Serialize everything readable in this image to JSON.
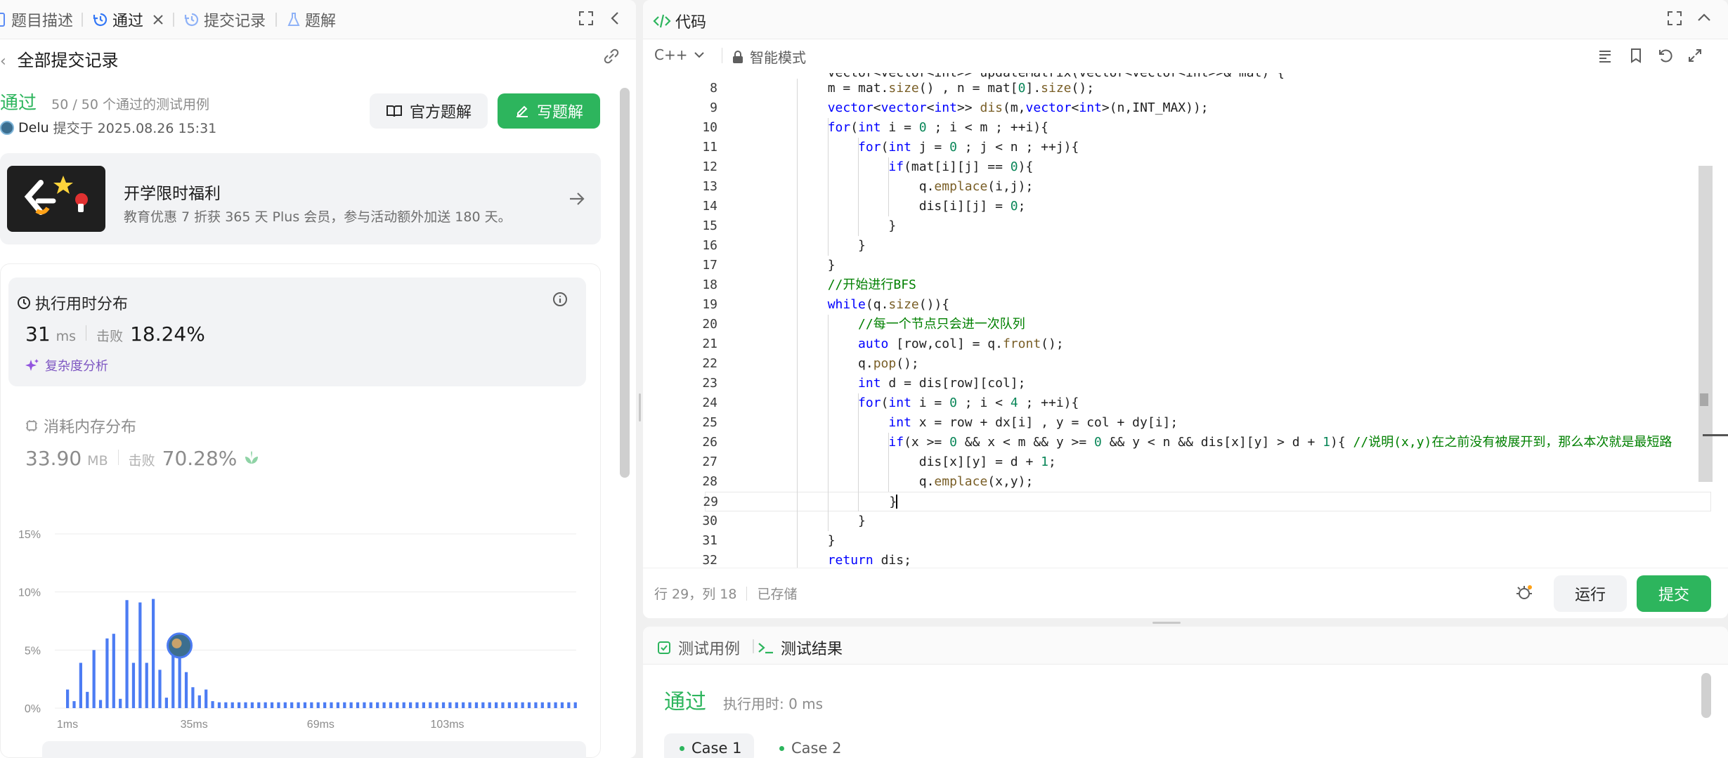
{
  "left_tabs": {
    "description": "题目描述",
    "accepted": "通过",
    "submissions": "提交记录",
    "solutions": "题解"
  },
  "submission": {
    "header": "全部提交记录",
    "status": "通过",
    "passed_cases": "50 / 50 个通过的测试用例",
    "user": "Delu",
    "submitted_at": "提交于 2025.08.26 15:31",
    "official_solution_btn": "官方题解",
    "write_solution_btn": "写题解"
  },
  "promo": {
    "title": "开学限时福利",
    "desc": "教育优惠 7 折获 365 天 Plus 会员，参与活动额外加送 180 天。"
  },
  "runtime": {
    "title": "执行用时分布",
    "value": "31",
    "unit": "ms",
    "beats_label": "击败",
    "beats": "18.24%",
    "complexity_link": "复杂度分析"
  },
  "memory": {
    "title": "消耗内存分布",
    "value": "33.90",
    "unit": "MB",
    "beats_label": "击败",
    "beats": "70.28%"
  },
  "chart_data": {
    "type": "bar",
    "title": "",
    "y_ticks": [
      "15%",
      "10%",
      "5%",
      "0%"
    ],
    "ylim": [
      0,
      15
    ],
    "x_ticks": [
      "1ms",
      "35ms",
      "69ms",
      "103ms"
    ],
    "values": [
      1.6,
      0.6,
      3.9,
      1.4,
      5.0,
      0.7,
      6.0,
      6.4,
      0.8,
      9.3,
      3.9,
      9.1,
      3.9,
      9.4,
      3.3,
      0.9,
      5.7,
      4.3,
      3.1,
      1.8,
      1.1,
      1.6,
      0.6,
      0.5,
      0.5,
      0.5,
      0.5,
      0.5,
      0.5,
      0.5,
      0.5,
      0.5,
      0.5,
      0.5,
      0.5,
      0.5,
      0.5,
      0.5,
      0.5,
      0.5,
      0.5,
      0.5,
      0.5,
      0.5,
      0.5,
      0.5,
      0.5,
      0.5,
      0.5,
      0.5,
      0.5,
      0.5,
      0.5,
      0.5,
      0.5,
      0.5,
      0.5,
      0.5,
      0.5,
      0.5,
      0.5,
      0.5,
      0.5,
      0.5,
      0.5,
      0.5,
      0.5,
      0.5,
      0.5,
      0.5,
      0.5,
      0.5,
      0.5,
      0.5,
      0.5,
      0.5,
      0.5,
      0.5
    ],
    "highlight_index": 17,
    "bar_color": "#4c7cf3"
  },
  "code_panel": {
    "title": "代码",
    "language": "C++",
    "mode": "智能模式",
    "cursor_pos": "行 29，列 18",
    "saved": "已存储",
    "run_btn": "运行",
    "submit_btn": "提交"
  },
  "code_lines": [
    {
      "n": "8",
      "text": "        m = mat.size() , n = mat[0].size();"
    },
    {
      "n": "9",
      "text": "        vector<vector<int>> dis(m,vector<int>(n,INT_MAX));"
    },
    {
      "n": "10",
      "text": "        for(int i = 0 ; i < m ; ++i){"
    },
    {
      "n": "11",
      "text": "            for(int j = 0 ; j < n ; ++j){"
    },
    {
      "n": "12",
      "text": "                if(mat[i][j] == 0){"
    },
    {
      "n": "13",
      "text": "                    q.emplace(i,j);"
    },
    {
      "n": "14",
      "text": "                    dis[i][j] = 0;"
    },
    {
      "n": "15",
      "text": "                }"
    },
    {
      "n": "16",
      "text": "            }"
    },
    {
      "n": "17",
      "text": "        }"
    },
    {
      "n": "18",
      "text": "        //开始进行BFS"
    },
    {
      "n": "19",
      "text": "        while(q.size()){"
    },
    {
      "n": "20",
      "text": "            //每一个节点只会进一次队列"
    },
    {
      "n": "21",
      "text": "            auto [row,col] = q.front();"
    },
    {
      "n": "22",
      "text": "            q.pop();"
    },
    {
      "n": "23",
      "text": "            int d = dis[row][col];"
    },
    {
      "n": "24",
      "text": "            for(int i = 0 ; i < 4 ; ++i){"
    },
    {
      "n": "25",
      "text": "                int x = row + dx[i] , y = col + dy[i];"
    },
    {
      "n": "26",
      "text": "                if(x >= 0 && x < m && y >= 0 && y < n && dis[x][y] > d + 1){ //说明(x,y)在之前没有被展开到，那么本次就是最短路"
    },
    {
      "n": "27",
      "text": "                    dis[x][y] = d + 1;"
    },
    {
      "n": "28",
      "text": "                    q.emplace(x,y);"
    },
    {
      "n": "29",
      "text": "                }"
    },
    {
      "n": "30",
      "text": "            }"
    },
    {
      "n": "31",
      "text": "        }"
    },
    {
      "n": "32",
      "text": "        return dis;"
    }
  ],
  "test_panel": {
    "tab_cases": "测试用例",
    "tab_result": "测试结果",
    "status": "通过",
    "runtime": "执行用时: 0 ms",
    "case1": "Case 1",
    "case2": "Case 2"
  }
}
